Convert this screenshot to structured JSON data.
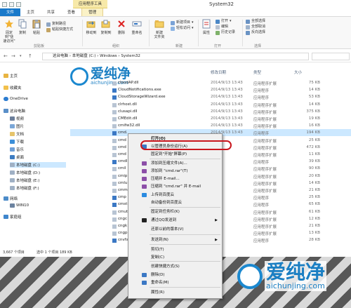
{
  "window": {
    "context_tab": "应用程序工具",
    "title": "System32"
  },
  "ribbon_tabs": [
    "文件",
    "主页",
    "共享",
    "查看",
    "管理"
  ],
  "ribbon": {
    "pin_label": "固定到\"快\n速访问\"",
    "copy_label": "复制",
    "paste_label": "粘贴",
    "copy_path_label": "复制路径",
    "paste_shortcut_label": "粘贴快捷方式",
    "clipboard_group": "剪贴板",
    "move_to_label": "移动到",
    "copy_to_label": "复制到",
    "delete_label": "删除",
    "rename_label": "重命名",
    "organize_group": "组织",
    "new_item_label": "新建项目",
    "easy_access_label": "轻松访问",
    "new_folder_label": "新建\n文件夹",
    "new_group": "新建",
    "properties_label": "属性",
    "open_label": "打开",
    "edit_label": "编辑",
    "history_label": "历史记录",
    "open_group": "打开",
    "select_all_label": "全部选择",
    "select_none_label": "全部取消",
    "invert_selection_label": "反向选择",
    "select_group": "选择"
  },
  "address": {
    "crumbs": "这台电脑 › 本地磁盘 (C:) › Windows › System32"
  },
  "nav": {
    "quick_access": "主页",
    "favorites": "收藏夹",
    "onedrive": "OneDrive",
    "this_pc": "这台电脑",
    "videos": "视频",
    "pictures": "图片",
    "documents": "文档",
    "downloads": "下载",
    "music": "音乐",
    "desktop": "桌面",
    "drive_c": "本地磁盘 (C:)",
    "drive_d": "本地磁盘 (D:)",
    "drive_e": "本地磁盘 (E:)",
    "drive_f": "本地磁盘 (F:)",
    "network": "网络",
    "win10": "WIN10",
    "homegroup": "家庭组"
  },
  "columns": {
    "modified": "修改日期",
    "type": "类型",
    "size": "大小"
  },
  "files": [
    {
      "name": "cloudAP.dll",
      "date": "2014/9/13 13:43",
      "type": "应用程序扩展",
      "size": "75 KB"
    },
    {
      "name": "CloudNotifications.exe",
      "date": "2014/9/13 13:43",
      "type": "应用程序",
      "size": "14 KB"
    },
    {
      "name": "CloudStorageWizard.exe",
      "date": "2014/9/13 13:43",
      "type": "应用程序",
      "size": "53 KB"
    },
    {
      "name": "clrhost.dll",
      "date": "2014/9/13 13:43",
      "type": "应用程序扩展",
      "size": "14 KB"
    },
    {
      "name": "clusapi.dll",
      "date": "2014/9/13 13:43",
      "type": "应用程序扩展",
      "size": "375 KB"
    },
    {
      "name": "CMEdit.dll",
      "date": "2014/9/13 13:43",
      "type": "应用程序扩展",
      "size": "19 KB"
    },
    {
      "name": "cmifw32.dll",
      "date": "2014/9/13 13:43",
      "type": "应用程序扩展",
      "size": "16 KB"
    },
    {
      "name": "cmd.",
      "date": "2014/9/13 13:43",
      "type": "应用程序",
      "size": "194 KB"
    },
    {
      "name": "cmd",
      "date": "",
      "type": "应用程序扩展",
      "size": "25 KB"
    },
    {
      "name": "cmd",
      "date": "",
      "type": "应用程序扩展",
      "size": "472 KB"
    },
    {
      "name": "cmd",
      "date": "",
      "type": "应用程序扩展",
      "size": "11 KB"
    },
    {
      "name": "cmdl",
      "date": "",
      "type": "应用程序",
      "size": "39 KB"
    },
    {
      "name": "cmil",
      "date": "",
      "type": "应用程序扩展",
      "size": "90 KB"
    },
    {
      "name": "cmip",
      "date": "",
      "type": "应用程序扩展",
      "size": "20 KB"
    },
    {
      "name": "cmlu",
      "date": "",
      "type": "应用程序扩展",
      "size": "14 KB"
    },
    {
      "name": "cmm",
      "date": "",
      "type": "应用程序扩展",
      "size": "21 KB"
    },
    {
      "name": "cmp",
      "date": "",
      "type": "应用程序",
      "size": "25 KB"
    },
    {
      "name": "cmst",
      "date": "",
      "type": "应用程序",
      "size": "65 KB"
    },
    {
      "name": "cmut",
      "date": "",
      "type": "应用程序扩展",
      "size": "61 KB"
    },
    {
      "name": "cngc",
      "date": "",
      "type": "应用程序扩展",
      "size": "12 KB"
    },
    {
      "name": "cngk",
      "date": "",
      "type": "应用程序扩展",
      "size": "21 KB"
    },
    {
      "name": "cngp",
      "date": "",
      "type": "应用程序扩展",
      "size": "13 KB"
    },
    {
      "name": "cnvfa",
      "date": "",
      "type": "应用程序",
      "size": "28 KB"
    }
  ],
  "status": {
    "count": "3,667 个项目",
    "selected": "选中 1 个项目 189 KB"
  },
  "context_menu": {
    "items": [
      {
        "label": "打开(O)",
        "bold": true,
        "icon": ""
      },
      {
        "label": "以管理员身份运行(A)",
        "icon": "shield-icon"
      },
      {
        "label": "固定到\"开始\"屏幕(P)",
        "icon": ""
      },
      {
        "label": "添加到压缩文件(A)...",
        "icon": "archive-icon"
      },
      {
        "label": "添加到 \"cmd.rar\"(T)",
        "icon": "archive-icon"
      },
      {
        "label": "压缩并 E-mail...",
        "icon": "archive-icon"
      },
      {
        "label": "压缩到 \"cmd.rar\" 并 E-mail",
        "icon": "archive-icon"
      },
      {
        "label": "上传到百度云",
        "icon": "cloud-icon"
      },
      {
        "label": "自动备份到百度云",
        "icon": ""
      },
      {
        "label": "固定到任务栏(K)",
        "icon": ""
      },
      {
        "label": "通过QQ发送到",
        "icon": "qq-icon",
        "submenu": true
      },
      {
        "label": "还原以前的版本(V)",
        "icon": ""
      },
      {
        "label": "发送到(N)",
        "icon": "",
        "submenu": true
      },
      {
        "label": "剪切(T)",
        "icon": ""
      },
      {
        "label": "复制(C)",
        "icon": ""
      },
      {
        "label": "创建快捷方式(S)",
        "icon": ""
      },
      {
        "label": "删除(D)",
        "icon": "delete-shield-icon"
      },
      {
        "label": "重命名(M)",
        "icon": "rename-shield-icon"
      },
      {
        "label": "属性(R)",
        "icon": ""
      }
    ]
  },
  "watermark": {
    "brand": "爱纯净",
    "url": "aichunjing.com"
  },
  "colors": {
    "accent": "#1979ca",
    "selection": "#cce8ff",
    "highlight_ring": "#c8161d",
    "watermark": "#1b7fc3"
  }
}
